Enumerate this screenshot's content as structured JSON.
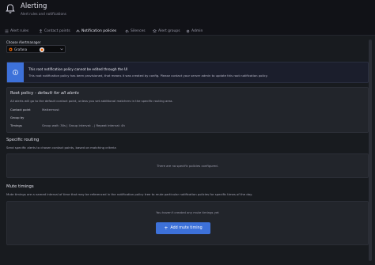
{
  "header": {
    "title": "Alerting",
    "subtitle": "Alert rules and notifications",
    "icon": "bell-icon"
  },
  "tabs": [
    {
      "label": "Alert rules",
      "icon": "list-icon",
      "active": false
    },
    {
      "label": "Contact points",
      "icon": "contact-icon",
      "active": false
    },
    {
      "label": "Notification policies",
      "icon": "sitemap-icon",
      "active": true
    },
    {
      "label": "Silences",
      "icon": "silence-icon",
      "active": false
    },
    {
      "label": "Alert groups",
      "icon": "layers-icon",
      "active": false
    },
    {
      "label": "Admin",
      "icon": "gear-icon",
      "active": false
    }
  ],
  "alertmanager": {
    "label": "Choose Alertmanager",
    "selected": "Grafana"
  },
  "info": {
    "title": "This root notification policy cannot be edited through the UI",
    "text": "This root notification policy has been provisioned, that means it was created by config. Please contact your server admin to update this root notification policy."
  },
  "root_policy": {
    "title": "Root policy - ",
    "title_em": "default for all alerts",
    "description": "All alerts will go to the default contact point, unless you set additional matchers in the specific routing area.",
    "rows": [
      {
        "key": "Contact point",
        "value": "Mattermost"
      },
      {
        "key": "Group by",
        "value": ""
      },
      {
        "key": "Timings",
        "value": "Group wait: 30s | Group interval: - | Repeat interval: 4h"
      }
    ]
  },
  "specific_routing": {
    "title": "Specific routing",
    "description": "Send specific alerts to chosen contact points, based on matching criteria",
    "empty": "There are no specific policies configured."
  },
  "mute_timings": {
    "title": "Mute timings",
    "description": "Mute timings are a named interval of time that may be referenced in the notification policy tree to mute particular notification policies for specific times of the day.",
    "empty": "You haven't created any mute timings yet",
    "button": "Add mute timing"
  },
  "colors": {
    "accent": "#3d71d9",
    "active_tab": "#f55f3e",
    "background": "#111217",
    "panel": "#22252b"
  }
}
